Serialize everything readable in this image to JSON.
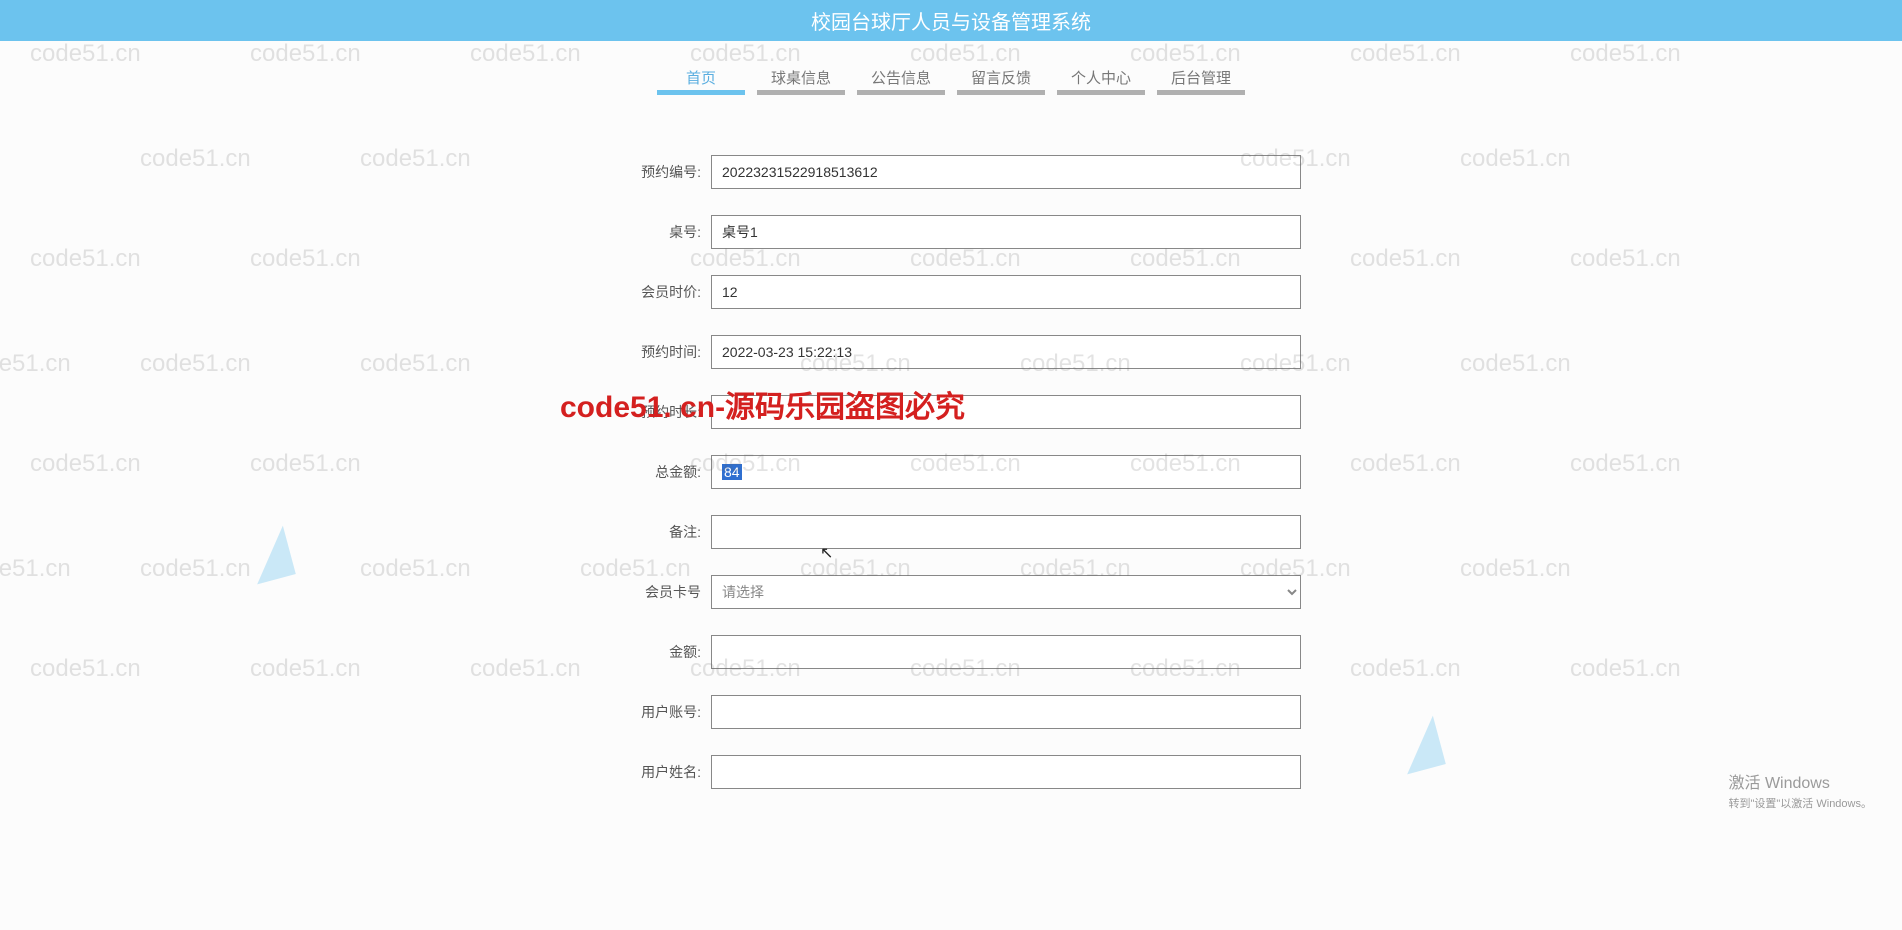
{
  "header": {
    "title": "校园台球厅人员与设备管理系统"
  },
  "nav": {
    "tabs": [
      {
        "label": "首页",
        "active": true
      },
      {
        "label": "球桌信息",
        "active": false
      },
      {
        "label": "公告信息",
        "active": false
      },
      {
        "label": "留言反馈",
        "active": false
      },
      {
        "label": "个人中心",
        "active": false
      },
      {
        "label": "后台管理",
        "active": false
      }
    ]
  },
  "form": {
    "fields": [
      {
        "label": "预约编号:",
        "value": "2022323152291851361​2",
        "type": "text"
      },
      {
        "label": "桌号:",
        "value": "桌号1",
        "type": "text"
      },
      {
        "label": "会员时价:",
        "value": "12",
        "type": "text"
      },
      {
        "label": "预约时间:",
        "value": "2022-03-23 15:22:13",
        "type": "text"
      },
      {
        "label": "预约时长:",
        "value": "",
        "type": "text"
      },
      {
        "label": "总金额:",
        "value": "84",
        "type": "text-highlight"
      },
      {
        "label": "备注:",
        "value": "",
        "type": "text"
      },
      {
        "label": "会员卡号",
        "value": "",
        "type": "select",
        "placeholder": "请选择"
      },
      {
        "label": "金额:",
        "value": "",
        "type": "text"
      },
      {
        "label": "用户账号:",
        "value": "",
        "type": "text"
      },
      {
        "label": "用户姓名:",
        "value": "",
        "type": "text"
      }
    ]
  },
  "watermark": {
    "text": "code51.cn",
    "center": "code51. cn-源码乐园盗图必究"
  },
  "activation": {
    "title": "激活 Windows",
    "sub": "转到\"设置\"以激活 Windows。"
  }
}
